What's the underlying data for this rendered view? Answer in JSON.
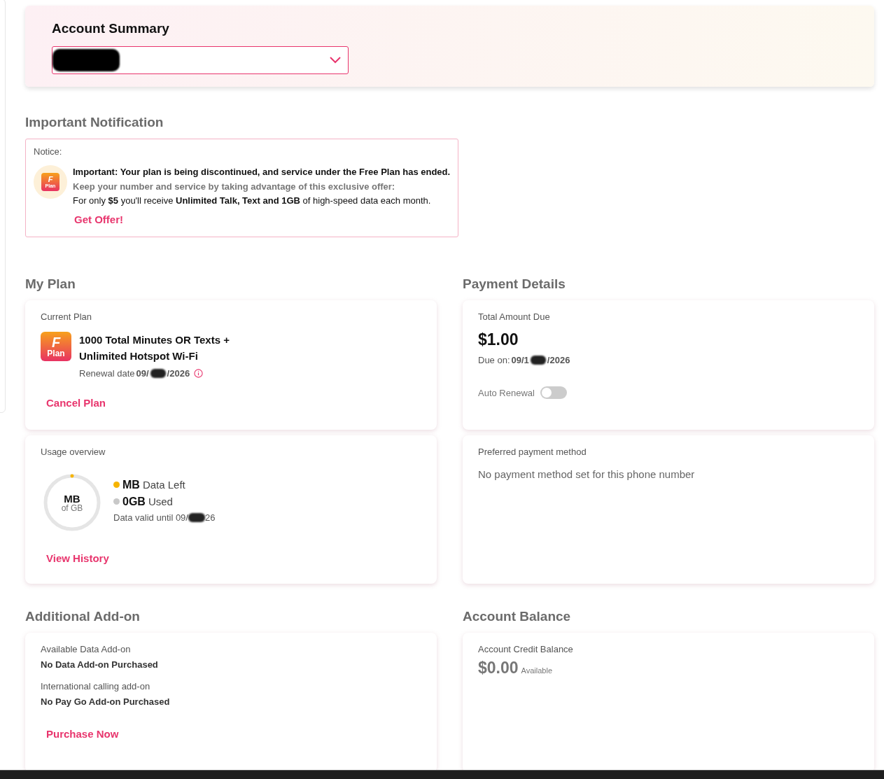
{
  "account_summary": {
    "title": "Account Summary",
    "selector": {
      "value_redacted": true
    }
  },
  "notification": {
    "heading": "Important Notification",
    "label": "Notice:",
    "headline": "Important: Your plan is being discontinued, and service under the Free Plan has ended.",
    "subline": "Keep your number and service by taking advantage of this exclusive offer:",
    "offer": "For only **$5** you'll receive **Unlimited Talk, Text and 1GB** of high-speed data each month.",
    "icon_letter": "F",
    "icon_text": "Plan",
    "action": "Get Offer!"
  },
  "my_plan": {
    "heading": "My Plan",
    "label": "Current Plan",
    "icon_letter": "F",
    "icon_text": "Plan",
    "plan_name": "1000 Total Minutes OR Texts + Unlimited Hotspot Wi-Fi",
    "renewal_label": "Renewal date",
    "renewal_date_start": "09/",
    "renewal_date_end": "/2026",
    "action": "Cancel Plan"
  },
  "usage": {
    "label": "Usage overview",
    "ring_value": "MB",
    "ring_total": "of GB",
    "level": 0.0,
    "left_amount": "MB",
    "left_label": "Data Left",
    "used_amount": "0GB",
    "used_label": "Used",
    "valid_label": "Data valid until 09/",
    "valid_end": "26",
    "action": "View History"
  },
  "payment": {
    "heading": "Payment Details",
    "label": "Total Amount Due",
    "amount": "$1.00",
    "due_label": "Due on:",
    "due_date_start": "09/1",
    "due_date_end": "/2026",
    "auto_renewal_label": "Auto Renewal",
    "auto_renewal_on": false
  },
  "payment_method": {
    "label": "Preferred payment method",
    "message": "No payment method set for this phone number"
  },
  "addons": {
    "heading": "Additional Add-on",
    "items": [
      {
        "label": "Available Data Add-on",
        "value": "No Data Add-on Purchased"
      },
      {
        "label": "International calling add-on",
        "value": "No Pay Go Add-on Purchased"
      }
    ],
    "action": "Purchase Now"
  },
  "balance": {
    "heading": "Account Balance",
    "label": "Account Credit Balance",
    "amount": "$0.00",
    "suffix": "Available"
  }
}
